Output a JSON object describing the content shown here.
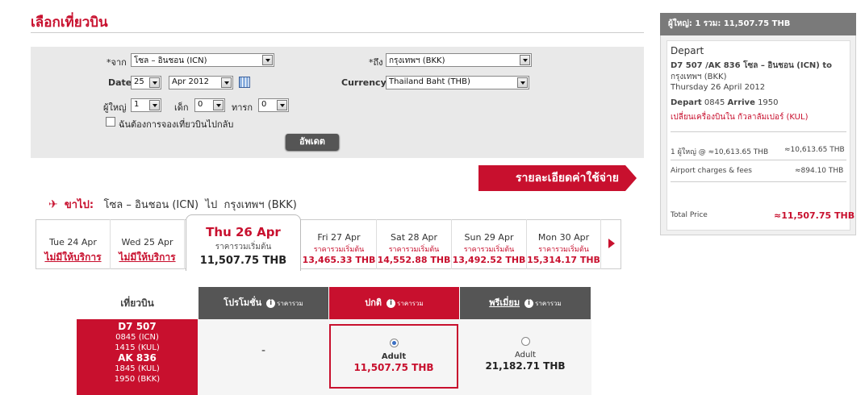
{
  "page_title": "เลือกเที่ยวบิน",
  "search": {
    "from_label": "*จาก",
    "from_value": "โซล – อินชอน (ICN)",
    "to_label": "*ถึง",
    "to_value": "กรุงเทพฯ (BKK)",
    "date_label": "Date",
    "date_day": "25",
    "date_month": "Apr 2012",
    "currency_label": "Currency",
    "currency_value": "Thailand Baht (THB)",
    "adult_label": "ผู้ใหญ่",
    "adult_value": "1",
    "child_label": "เด็ก",
    "child_value": "0",
    "infant_label": "ทารก",
    "infant_value": "0",
    "return_label": "ฉันต้องการจองเที่ยวบินไปกลับ",
    "update_button": "อัพเดต"
  },
  "fare_detail_button": "รายละเอียดค่าใช้จ่าย",
  "route": {
    "prefix": "ขาไป:",
    "origin": "โซล – อินชอน (ICN)",
    "connector": "ไป",
    "destination": "กรุงเทพฯ (BKK)"
  },
  "date_tabs": [
    {
      "day": "Tue 24 Apr",
      "status": "ไม่มีให้บริการ"
    },
    {
      "day": "Wed 25 Apr",
      "status": "ไม่มีให้บริการ"
    },
    {
      "day": "Thu 26 Apr",
      "price_label": "ราคารวมเริ่มต้น",
      "price": "11,507.75 THB",
      "selected": true
    },
    {
      "day": "Fri 27 Apr",
      "price_label": "ราคารวมเริ่มต้น",
      "price": "13,465.33 THB"
    },
    {
      "day": "Sat 28 Apr",
      "price_label": "ราคารวมเริ่มต้น",
      "price": "14,552.88 THB"
    },
    {
      "day": "Sun 29 Apr",
      "price_label": "ราคารวมเริ่มต้น",
      "price": "13,492.52 THB"
    },
    {
      "day": "Mon 30 Apr",
      "price_label": "ราคารวมเริ่มต้น",
      "price": "15,314.17 THB"
    }
  ],
  "fare_table": {
    "flight_header": "เที่ยวบิน",
    "promo_header": "โปรโมชั่น",
    "regular_header": "ปกติ",
    "premium_header": "พรีเมี่ยม",
    "total_hint": "ราคารวม",
    "flight": {
      "leg1_number": "D7  507",
      "leg1_dep": "0845  (ICN)",
      "leg1_arr": "1415  (KUL)",
      "leg2_number": "AK  836",
      "leg2_dep": "1845  (KUL)",
      "leg2_arr": "1950  (BKK)"
    },
    "promo_value": "-",
    "regular_pax": "Adult",
    "regular_price": "11,507.75 THB",
    "premium_pax": "Adult",
    "premium_price": "21,182.71 THB"
  },
  "summary": {
    "header": "ผู้ใหญ่: 1  รวม: 11,507.75 THB",
    "depart_title": "Depart",
    "flight_line1": "D7 507 /AK 836 โซล – อินชอน (ICN) to",
    "flight_line2": "กรุงเทพฯ (BKK)",
    "date": "Thursday 26 April 2012",
    "depart_label": "Depart",
    "depart_time": "0845",
    "arrive_label": "Arrive",
    "arrive_time": "1950",
    "transfer": "เปลี่ยนเครื่องบินใน กัวลาลัมเปอร์ (KUL)",
    "fare_line_label": "1 ผู้ใหญ่ @ ≈10,613.65 THB",
    "fare_line_value": "≈10,613.65 THB",
    "charges_label": "Airport charges & fees",
    "charges_value": "≈894.10 THB",
    "total_label": "Total Price",
    "total_value": "≈11,507.75 THB"
  },
  "colors": {
    "accent": "#c8102e",
    "header_gray": "#555555",
    "panel_gray": "#e9e9e9"
  }
}
